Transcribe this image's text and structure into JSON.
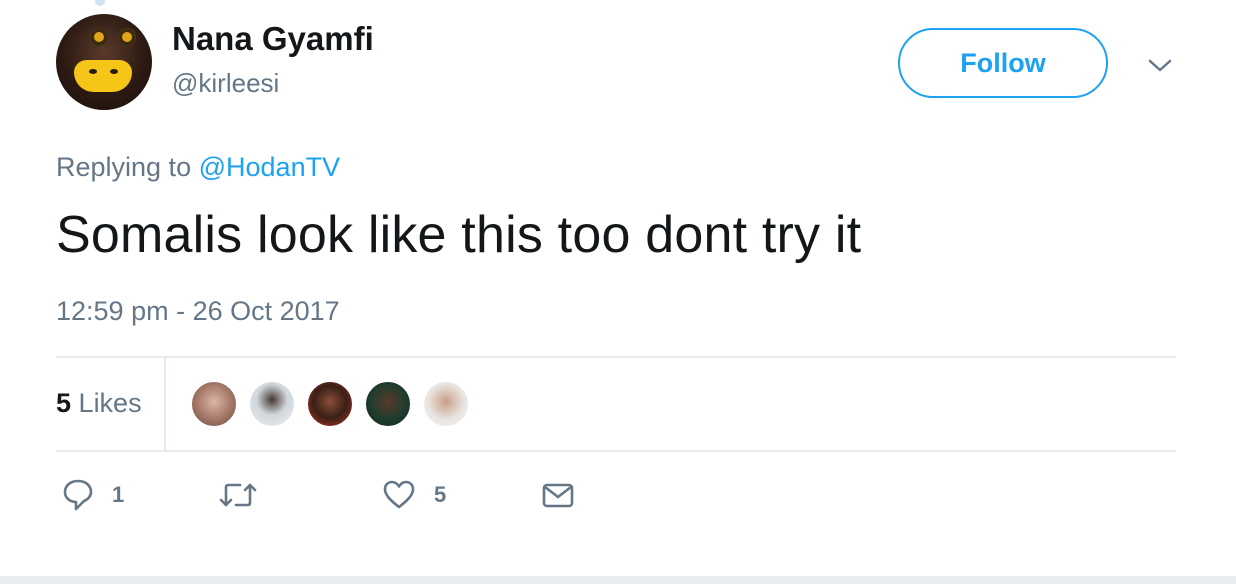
{
  "user": {
    "name": "Nana Gyamfi",
    "handle": "@kirleesi"
  },
  "follow_button": {
    "label": "Follow"
  },
  "reply": {
    "prefix": "Replying to",
    "mention": "@HodanTV"
  },
  "tweet": {
    "text": "Somalis look like this too dont try it",
    "timestamp": "12:59 pm - 26 Oct 2017"
  },
  "likes": {
    "count": "5",
    "label": "Likes"
  },
  "actions": {
    "reply_count": "1",
    "like_count": "5"
  },
  "icons": [
    "chevron-down-icon",
    "reply-icon",
    "retweet-icon",
    "heart-icon",
    "envelope-icon"
  ],
  "colors": {
    "accent": "#1da1f2",
    "secondary_text": "#657786",
    "primary_text": "#14171a",
    "divider": "#e6ecf0"
  }
}
